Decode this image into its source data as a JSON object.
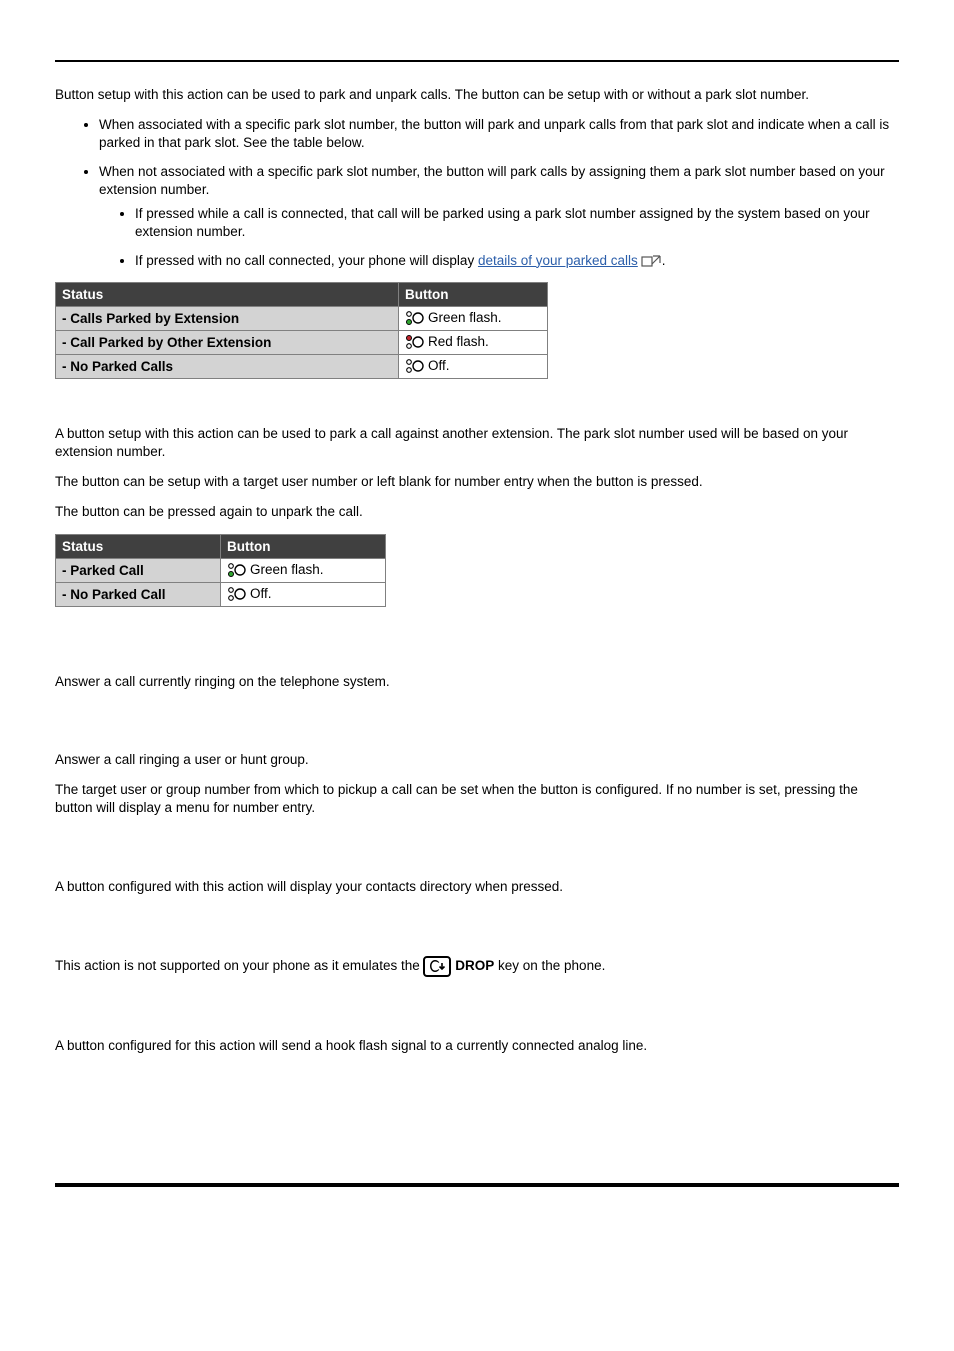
{
  "call_park": {
    "intro": "Button setup with this action can be used to park and unpark calls. The button can be setup with or without a park slot number.",
    "bullet1": "When associated with a specific park slot number, the button will park and unpark calls from that park slot and indicate when a call is parked in that park slot. See the table below.",
    "bullet2": "When not associated with a specific park slot number, the button will park calls by assigning them a park slot number based on your extension number.",
    "sub_bullet1": "If pressed while a call is connected, that call will be parked using a park slot number assigned by the system based on your extension number.",
    "sub_bullet2_prefix": "If pressed with no call connected, your phone will display ",
    "sub_bullet2_link": "details of your parked calls",
    "table": {
      "headers": {
        "status": "Status",
        "button": "Button"
      },
      "rows": [
        {
          "status": "- Calls Parked by Extension",
          "button": "Green flash.",
          "lamp": "green"
        },
        {
          "status": "- Call Parked by Other Extension",
          "button": "Red flash.",
          "lamp": "red"
        },
        {
          "status": "- No Parked Calls",
          "button": "Off.",
          "lamp": "off"
        }
      ]
    }
  },
  "call_park_other": {
    "p1": "A button setup with this action can be used to park a call against another extension. The park slot number used will be based on your extension number.",
    "p2": "The button can be setup with a target user number or left blank for number entry when the button is pressed.",
    "p3": "The button can be pressed again to unpark the call.",
    "table": {
      "headers": {
        "status": "Status",
        "button": "Button"
      },
      "rows": [
        {
          "status": "- Parked Call",
          "button": "Green flash.",
          "lamp": "green"
        },
        {
          "status": "- No Parked Call",
          "button": "Off.",
          "lamp": "off"
        }
      ]
    }
  },
  "pickup_any": {
    "p1": "Answer a call currently ringing on the telephone system."
  },
  "pickup_uh": {
    "p1": "Answer a call ringing a user or hunt group.",
    "p2": "The target user or group number from which to pickup a call can be set when the button is configured. If no number is set, pressing the button will display a menu for number entry."
  },
  "directory": {
    "p1": "A button configured with this action will display your contacts directory when pressed."
  },
  "drop": {
    "prefix": "This action is not supported on your phone as it emulates the ",
    "key": "DROP",
    "suffix": " key on the phone."
  },
  "flash": {
    "p1": "A button configured for this action will send a hook flash signal to a currently connected analog line."
  }
}
